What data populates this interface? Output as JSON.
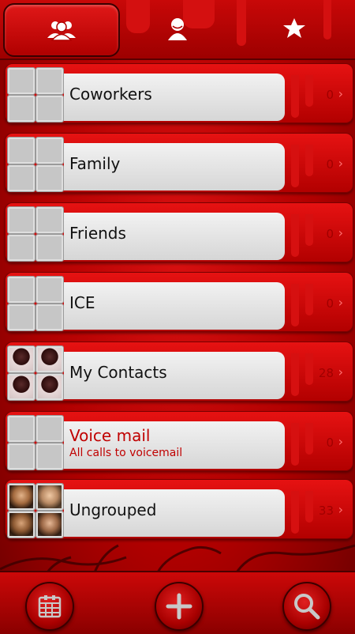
{
  "tabs": [
    {
      "icon": "groups-icon",
      "selected": true
    },
    {
      "icon": "contact-icon",
      "selected": false
    },
    {
      "icon": "favorites-star-icon",
      "selected": false
    }
  ],
  "groups": [
    {
      "name": "Coworkers",
      "count": "0"
    },
    {
      "name": "Family",
      "count": "0"
    },
    {
      "name": "Friends",
      "count": "0"
    },
    {
      "name": "ICE",
      "count": "0"
    },
    {
      "name": "My Contacts",
      "count": "28"
    },
    {
      "name": "Voice mail",
      "subtitle": "All calls to voicemail",
      "count": "0"
    },
    {
      "name": "Ungrouped",
      "count": "33"
    }
  ],
  "bottom_bar": {
    "buttons": [
      "calendar-grid-icon",
      "add-icon",
      "search-icon"
    ]
  },
  "colors": {
    "accent": "#c00000",
    "card": "#e6e6e6"
  }
}
